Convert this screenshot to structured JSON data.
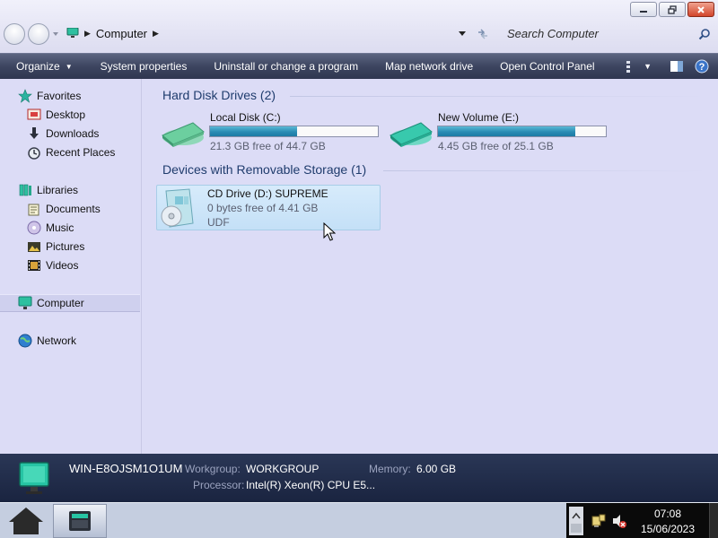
{
  "window": {
    "minimize_icon": "minimize-icon",
    "maximize_icon": "maximize-icon",
    "close_icon": "close-icon"
  },
  "address": {
    "crumbs": [
      "Computer"
    ]
  },
  "search": {
    "placeholder": "Search Computer"
  },
  "toolbar": {
    "organize": "Organize",
    "system_properties": "System properties",
    "uninstall": "Uninstall or change a program",
    "map_drive": "Map network drive",
    "control_panel": "Open Control Panel"
  },
  "nav": {
    "favorites": "Favorites",
    "desktop": "Desktop",
    "downloads": "Downloads",
    "recent_places": "Recent Places",
    "libraries": "Libraries",
    "documents": "Documents",
    "music": "Music",
    "pictures": "Pictures",
    "videos": "Videos",
    "computer": "Computer",
    "network": "Network"
  },
  "groups": {
    "hard_disks": "Hard Disk Drives (2)",
    "removable": "Devices with Removable Storage (1)"
  },
  "drives": [
    {
      "name": "Local Disk (C:)",
      "free_text": "21.3 GB free of 44.7 GB",
      "used_fraction": 0.52
    },
    {
      "name": "New Volume (E:)",
      "free_text": "4.45 GB free of 25.1 GB",
      "used_fraction": 0.82
    }
  ],
  "cd_drive": {
    "name": "CD Drive (D:) SUPREME",
    "free_text": "0 bytes free of 4.41 GB",
    "filesystem": "UDF"
  },
  "details": {
    "computer_name": "WIN-E8OJSM1O1UM",
    "workgroup_label": "Workgroup:",
    "workgroup_value": "WORKGROUP",
    "memory_label": "Memory:",
    "memory_value": "6.00 GB",
    "processor_label": "Processor:",
    "processor_value": "Intel(R) Xeon(R) CPU E5..."
  },
  "taskbar": {
    "time": "07:08",
    "date": "15/06/2023"
  },
  "colors": {
    "toolbar_bg": "#3d4560",
    "pane_bg": "#dcdcf6",
    "drive_bar": "#2a8cb4",
    "group_header": "#1f3c6d"
  }
}
